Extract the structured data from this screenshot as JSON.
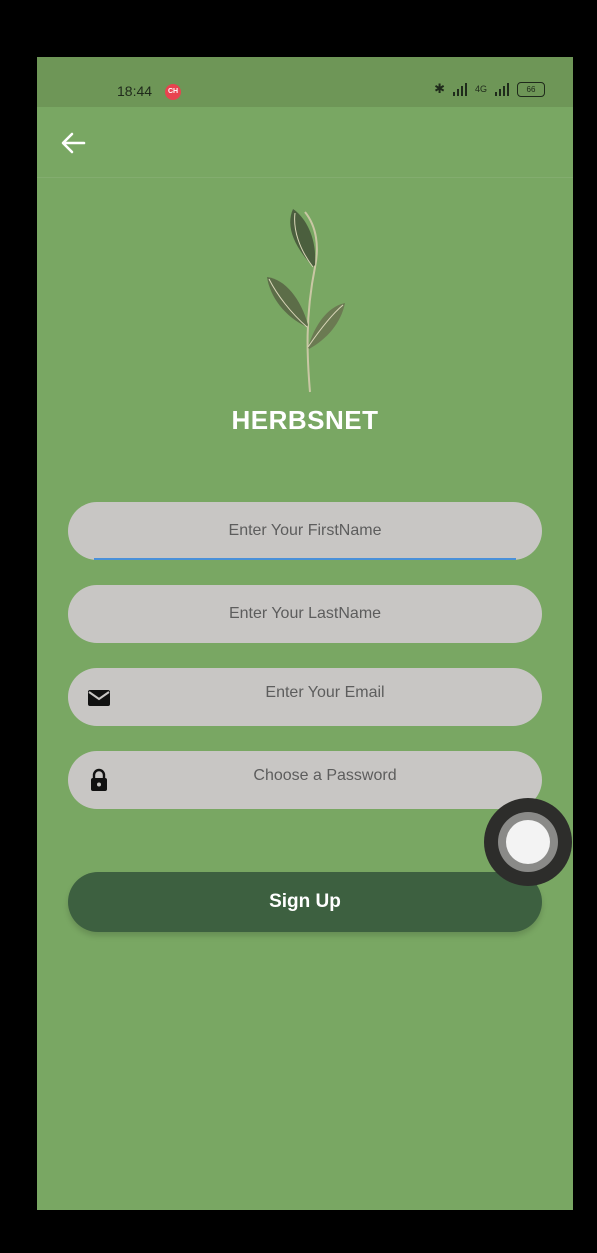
{
  "status_bar": {
    "time": "18:44",
    "record_badge": "CH",
    "network_label": "4G",
    "battery_level": "66"
  },
  "app": {
    "brand": "HERBSNET",
    "back_icon": "arrow-left-icon"
  },
  "form": {
    "first_name_placeholder": "Enter Your FirstName",
    "last_name_placeholder": "Enter Your LastName",
    "email_placeholder": "Enter Your Email",
    "password_placeholder": "Choose a Password",
    "email_icon": "envelope-icon",
    "password_icon": "lock-icon",
    "signup_label": "Sign Up"
  },
  "colors": {
    "background": "#79a763",
    "field": "#c8c6c4",
    "button": "#3d6040",
    "focus_underline": "#4a90d9"
  }
}
